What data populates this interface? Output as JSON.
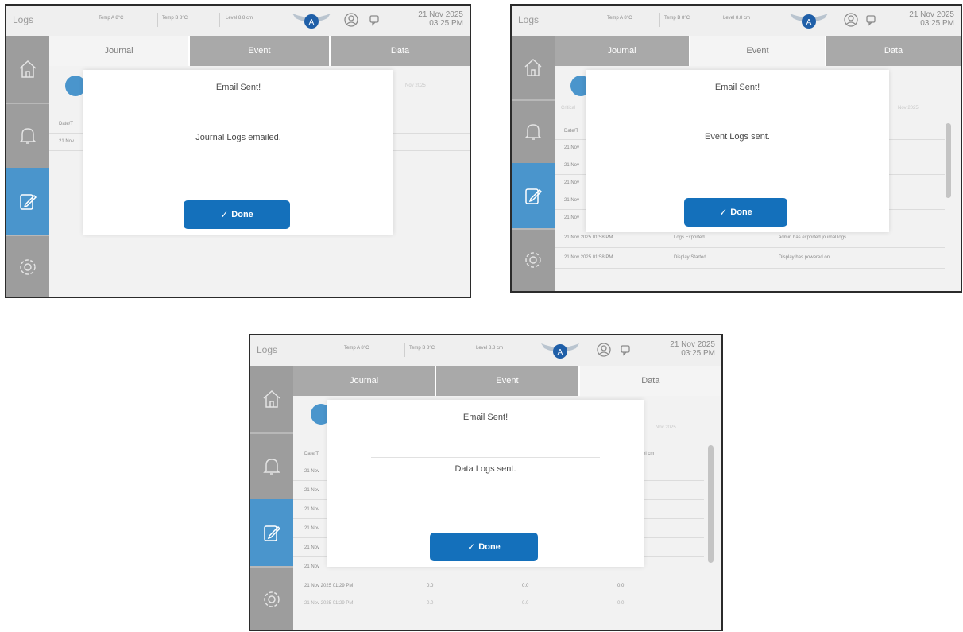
{
  "header": {
    "title": "Logs",
    "temp_a": "Temp A  8°C",
    "temp_b": "Temp B  8°C",
    "level": "Level  8.8 cm",
    "date": "21 Nov 2025",
    "time": "03:25 PM"
  },
  "tabs": {
    "journal": "Journal",
    "event": "Event",
    "data": "Data"
  },
  "accent_color": "#4a95cc",
  "button_color": "#1470bb",
  "screens": [
    {
      "active_tab": "Journal",
      "modal": {
        "title": "Email Sent!",
        "message": "Journal Logs emailed.",
        "done": "Done"
      },
      "background": {
        "col_header": "Date/T",
        "row1": "21 Nov",
        "date_filter": "Nov 2025"
      }
    },
    {
      "active_tab": "Event",
      "modal": {
        "title": "Email Sent!",
        "message": "Event Logs sent.",
        "done": "Done"
      },
      "background": {
        "label_left": "Critical",
        "col_header": "Date/T",
        "date_filter": "Nov 2025",
        "partial_rows": [
          "21 Nov",
          "21 Nov",
          "21 Nov",
          "21 Nov",
          "21 Nov"
        ],
        "rows": [
          {
            "time": "21 Nov 2025 01:58 PM",
            "type": "Logs Exported",
            "desc": "admin has exported journal logs."
          },
          {
            "time": "21 Nov 2025 01:58 PM",
            "type": "Display Started",
            "desc": "Display has powered on."
          }
        ]
      }
    },
    {
      "active_tab": "Data",
      "modal": {
        "title": "Email Sent!",
        "message": "Data Logs sent.",
        "done": "Done"
      },
      "background": {
        "col_header": "Date/T",
        "date_filter": "Nov 2025",
        "col_right": "el cm",
        "partial_rows": [
          "21 Nov",
          "21 Nov",
          "21 Nov",
          "21 Nov",
          "21 Nov",
          "21 Nov"
        ],
        "last_row": {
          "time": "21 Nov 2025 01:29 PM",
          "a": "0.0",
          "b": "0.0",
          "c": "0.0"
        },
        "cut_row": {
          "time": "21 Nov 2025 01:29 PM",
          "a": "0.0",
          "b": "0.0",
          "c": "0.0"
        }
      }
    }
  ],
  "icons": [
    "home-icon",
    "bell-icon",
    "edit-logs-icon",
    "gear-icon",
    "user-icon",
    "chat-icon",
    "brand-logo-icon",
    "checkmark-icon",
    "calendar-icon"
  ]
}
